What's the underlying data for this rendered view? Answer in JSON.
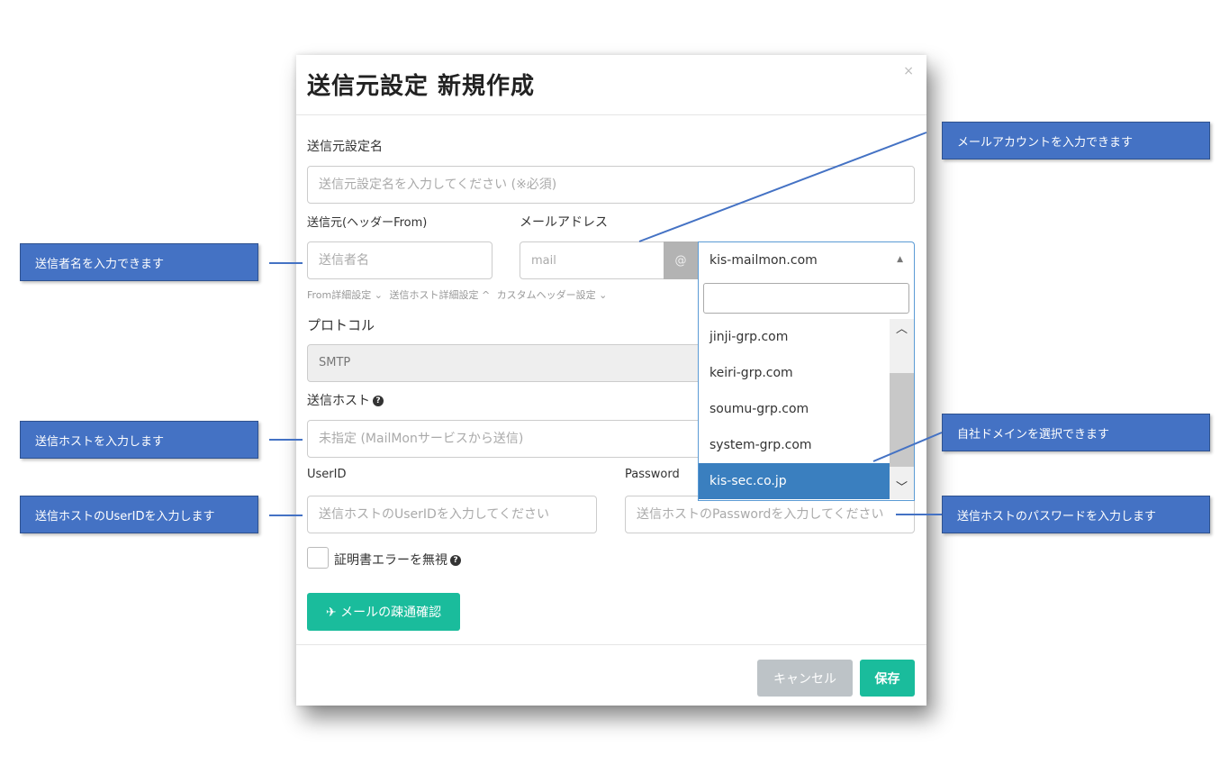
{
  "modal": {
    "title": "送信元設定 新規作成",
    "close": "×",
    "sender_setting_label": "送信元設定名",
    "sender_setting_placeholder": "送信元設定名を入力してください (※必須)",
    "from_label": "送信元(ヘッダーFrom)",
    "email_label": "メールアドレス",
    "sender_name_placeholder": "送信者名",
    "mail_placeholder": "mail",
    "at": "@",
    "domain_selected": "kis-mailmon.com",
    "links": [
      "From詳細設定 ⌄",
      "送信ホスト詳細設定 ^",
      "カスタムヘッダー設定 ⌄"
    ],
    "protocol_label": "プロトコル",
    "protocol_value": "SMTP",
    "host_label": "送信ホスト",
    "host_placeholder": "未指定 (MailMonサービスから送信)",
    "userid_label": "UserID",
    "password_label": "Password",
    "userid_placeholder": "送信ホストのUserIDを入力してください",
    "password_placeholder": "送信ホストのPasswordを入力してください",
    "ignore_cert_label": "証明書エラーを無視",
    "test_button": "メールの疎通確認",
    "cancel_button": "キャンセル",
    "save_button": "保存"
  },
  "dropdown": {
    "options": [
      "jinji-grp.com",
      "keiri-grp.com",
      "soumu-grp.com",
      "system-grp.com",
      "kis-sec.co.jp"
    ],
    "active_index": 4
  },
  "callouts": {
    "mail_account": "メールアカウントを入力できます",
    "sender_name": "送信者名を入力できます",
    "send_host": "送信ホストを入力します",
    "userid": "送信ホストのUserIDを入力します",
    "domain": "自社ドメインを選択できます",
    "password": "送信ホストのパスワードを入力します"
  },
  "colors": {
    "accent": "#1abc9c",
    "callout": "#4472c4",
    "selected": "#3a7fbf"
  }
}
